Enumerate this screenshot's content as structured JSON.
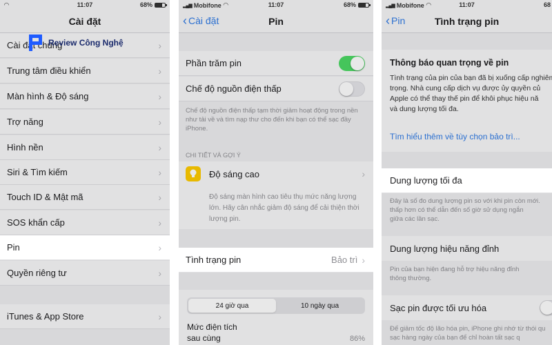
{
  "watermark": {
    "text": "Review Công Nghệ"
  },
  "colors": {
    "accent": "#2f7ae5",
    "toggle_on": "#4cd964",
    "logo_blue": "#1e5bff"
  },
  "panel1": {
    "status": {
      "time": "11:07",
      "battery": "68%"
    },
    "title": "Cài đặt",
    "items": [
      {
        "label": "Cài đặt chung"
      },
      {
        "label": "Trung tâm điều khiển"
      },
      {
        "label": "Màn hình & Độ sáng"
      },
      {
        "label": "Trợ năng"
      },
      {
        "label": "Hình nền"
      },
      {
        "label": "Siri & Tìm kiếm"
      },
      {
        "label": "Touch ID & Mật mã"
      },
      {
        "label": "SOS khẩn cấp"
      },
      {
        "label": "Pin"
      },
      {
        "label": "Quyền riêng tư"
      },
      {
        "label": "iTunes & App Store"
      }
    ]
  },
  "panel2": {
    "status": {
      "carrier": "Mobifone",
      "time": "11:07",
      "battery": "68%"
    },
    "back": "Cài đặt",
    "title": "Pin",
    "battery_percent": {
      "label": "Phần trăm pin",
      "on": true
    },
    "low_power": {
      "label": "Chế độ nguồn điện thấp",
      "on": false
    },
    "low_power_note": "Chế độ nguồn điện thấp tạm thời giảm hoạt động trong nền như tải về và tìm nạp thư cho đến khi bạn có thể sạc đầy iPhone.",
    "section_header": "CHI TIẾT VÀ GỢI Ý",
    "suggestion": {
      "label": "Độ sáng cao",
      "note": "Độ sáng màn hình cao tiêu thụ mức năng lượng lớn. Hãy cân nhắc giảm độ sáng để cải thiện thời lượng pin."
    },
    "health_row": {
      "label": "Tình trạng pin",
      "value": "Bảo trì"
    },
    "segments": [
      "24 giờ qua",
      "10 ngày qua"
    ],
    "last_charge": {
      "label_line1": "Mức điện tích",
      "label_line2": "sau cùng",
      "value": "86%"
    }
  },
  "panel3": {
    "status": {
      "carrier": "Mobifone",
      "time": "11:07",
      "battery": "68"
    },
    "back": "Pin",
    "title": "Tình trạng pin",
    "important": {
      "heading": "Thông báo quan trọng về pin",
      "lines": [
        "Tình trạng của pin của bạn đã bị xuống cấp nghiêm",
        "trọng. Nhà cung cấp dịch vụ được ủy quyền củ",
        "Apple có thể thay thế pin để khôi phục hiệu nă",
        "và dung lượng tối đa."
      ],
      "link": "Tìm hiểu thêm về tùy chọn bảo trì..."
    },
    "max_capacity": {
      "label": "Dung lượng tối đa",
      "note_lines": [
        "Đây là số đo dung lượng pin so với khi pin còn mới.",
        "thấp hơn có thể dẫn đến số giờ sử dụng ngắn",
        "giữa các lần sạc."
      ]
    },
    "peak": {
      "label": "Dung lượng hiệu năng đỉnh",
      "note_lines": [
        "Pin của bạn hiện đang hỗ trợ hiệu năng đỉnh",
        "thông thường."
      ]
    },
    "optimized": {
      "label": "Sạc pin được tối ưu hóa",
      "note_lines": [
        "Để giảm tốc độ lão hóa pin, iPhone ghi nhớ từ thói qu",
        "sạc hàng ngày của bạn để chỉ hoàn tất sạc q"
      ]
    }
  }
}
